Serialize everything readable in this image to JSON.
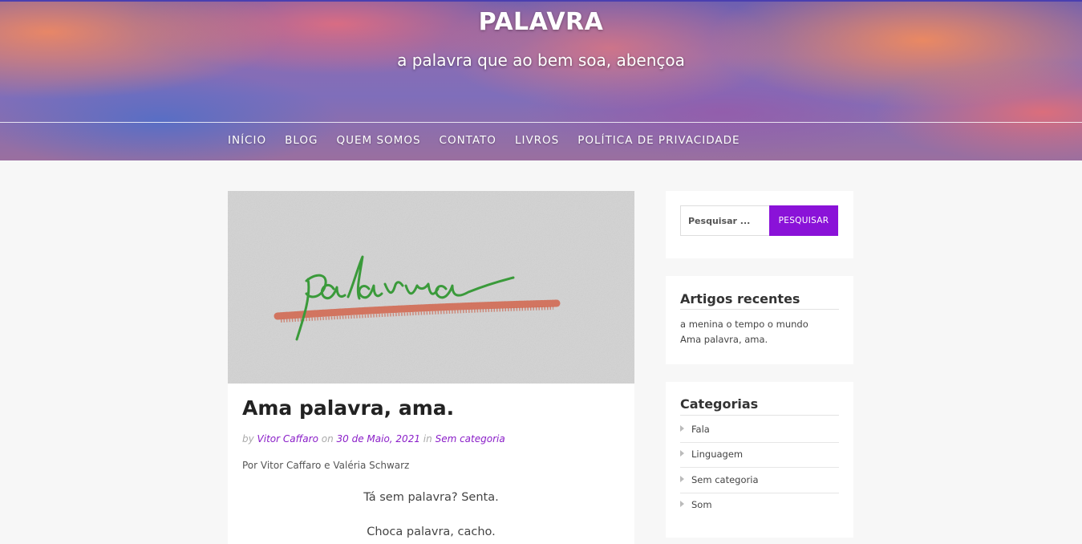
{
  "site": {
    "title": "PALAVRA",
    "tagline": "a palavra que ao bem soa, abençoa"
  },
  "nav": {
    "items": [
      "INÍCIO",
      "BLOG",
      "QUEM SOMOS",
      "CONTATO",
      "LIVROS",
      "POLÍTICA DE PRIVACIDADE"
    ]
  },
  "post": {
    "image_text": "palavra",
    "title": "Ama palavra, ama.",
    "meta": {
      "by_label": "by",
      "author": "Vitor Caffaro",
      "on_label": "on",
      "date": "30 de Maio, 2021",
      "in_label": "in",
      "category": "Sem categoria"
    },
    "byline": "Por Vitor Caffaro e Valéria Schwarz",
    "lines": [
      "Tá sem palavra?  Senta.",
      "Choca palavra, cacho."
    ]
  },
  "sidebar": {
    "search": {
      "placeholder": "Pesquisar ...",
      "button_label": "PESQUISAR"
    },
    "recent": {
      "title": "Artigos recentes",
      "items": [
        "a menina o tempo o mundo",
        "Ama palavra, ama."
      ]
    },
    "categories": {
      "title": "Categorias",
      "items": [
        "Fala",
        "Linguagem",
        "Sem categoria",
        "Som"
      ]
    }
  },
  "colors": {
    "accent": "#8a12d8",
    "link": "#8a1ec8",
    "page_bg": "#f7f7f7"
  }
}
